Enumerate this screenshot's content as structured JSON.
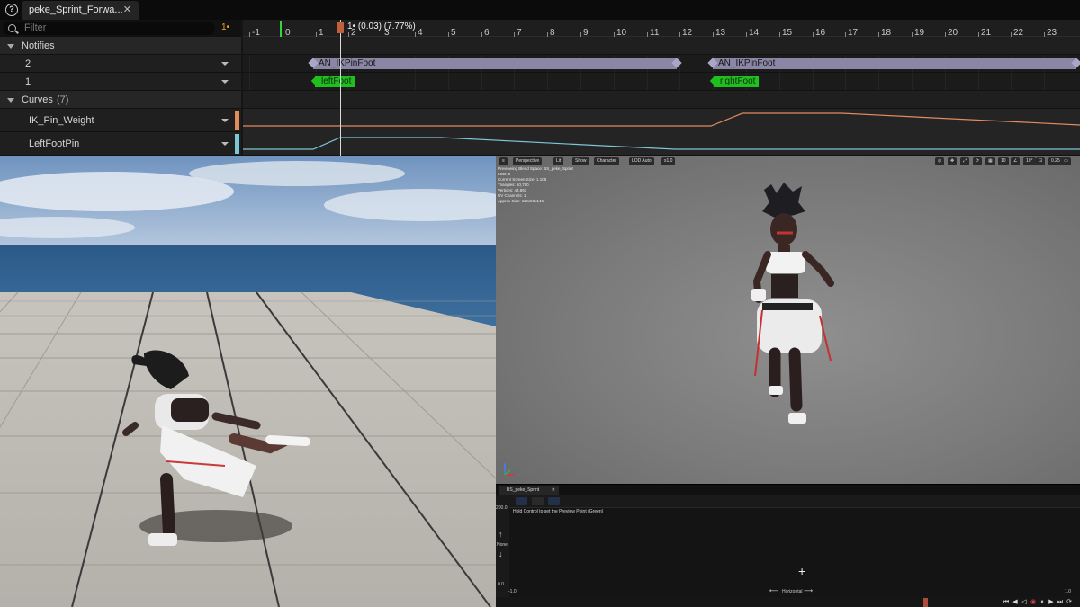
{
  "tab": {
    "title": "peke_Sprint_Forwa...",
    "close": "✕"
  },
  "filter": {
    "placeholder": "Filter",
    "frame_badge": "1•"
  },
  "tracks": {
    "notifies": "Notifies",
    "notify_track_a": "2",
    "notify_track_b": "1",
    "curves": "Curves",
    "curves_count": "(7)",
    "curve_a": "IK_Pin_Weight",
    "curve_b": "LeftFootPin"
  },
  "colors": {
    "curve_a": "#e28b5d",
    "curve_b": "#7cc6d6",
    "notify_bar": "#8a86a6",
    "notify_tag": "#1fbf1f",
    "playhead": "#c2603c"
  },
  "timeline": {
    "ticks": [
      "-1",
      "0",
      "1",
      "2",
      "3",
      "4",
      "5",
      "6",
      "7",
      "8",
      "9",
      "10",
      "11",
      "12",
      "13",
      "14",
      "15",
      "16",
      "17",
      "18",
      "19",
      "20",
      "21",
      "22",
      "23"
    ],
    "playhead_label": "1• (0.03) (7.77%)",
    "notify_1": "AN_IKPinFoot",
    "notify_2": "AN_IKPinFoot",
    "tag_1": "leftFoot",
    "tag_2": "rightFoot"
  },
  "viewport": {
    "toolbar": [
      "≡",
      "Perspective",
      "Lit",
      "Show",
      "Character",
      "LOD Auto",
      "x1.0"
    ],
    "right_toolbar": [
      "◎",
      "✥",
      "⤢",
      "⟳",
      "▦",
      "10",
      "∠",
      "10°",
      "⊡",
      "0.25",
      "▭"
    ],
    "stats": [
      "Previewing Blend Space: BS_peke_Sprint",
      "LOD: 0",
      "Current Screen Size: 1.108",
      "Triangles: 60,790",
      "Vertices: 43,892",
      "UV Channels: 1",
      "Approx Size: 119x59x146"
    ]
  },
  "blend": {
    "tab": "BS_peke_Sprint",
    "tab_close": "✕",
    "hint": "Hold Control to set the Preview Point (Green)",
    "y_max": "200.0",
    "y_min": "0.0",
    "y_name": "None",
    "x_min": "-1.0",
    "x_max": "1.0",
    "x_name": "Horizontal"
  }
}
